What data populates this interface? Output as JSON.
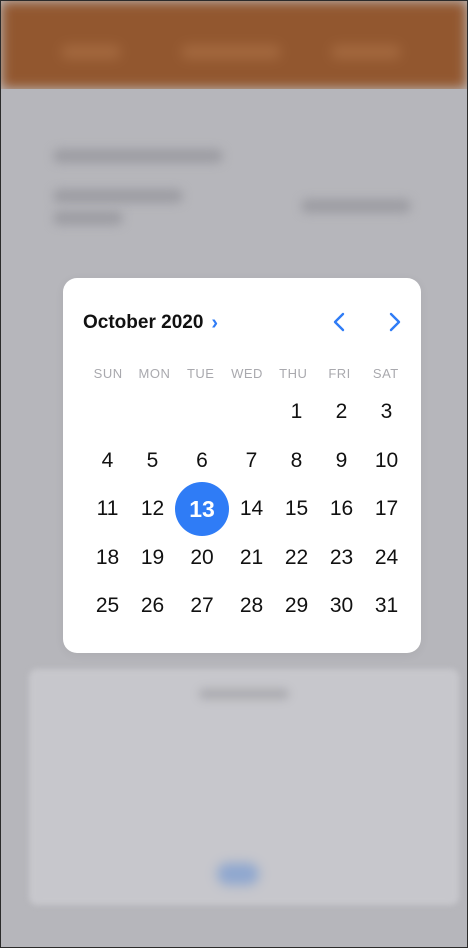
{
  "calendar": {
    "month_label": "October 2020",
    "weekdays": [
      "SUN",
      "MON",
      "TUE",
      "WED",
      "THU",
      "FRI",
      "SAT"
    ],
    "days": [
      "",
      "",
      "",
      "",
      "1",
      "2",
      "3",
      "4",
      "5",
      "6",
      "7",
      "8",
      "9",
      "10",
      "11",
      "12",
      "13",
      "14",
      "15",
      "16",
      "17",
      "18",
      "19",
      "20",
      "21",
      "22",
      "23",
      "24",
      "25",
      "26",
      "27",
      "28",
      "29",
      "30",
      "31"
    ],
    "selected_day": "13",
    "icons": {
      "expand": "chevron-right-icon",
      "prev": "chevron-left-icon",
      "next": "chevron-right-icon"
    },
    "accent_color": "#2f7cf6"
  }
}
